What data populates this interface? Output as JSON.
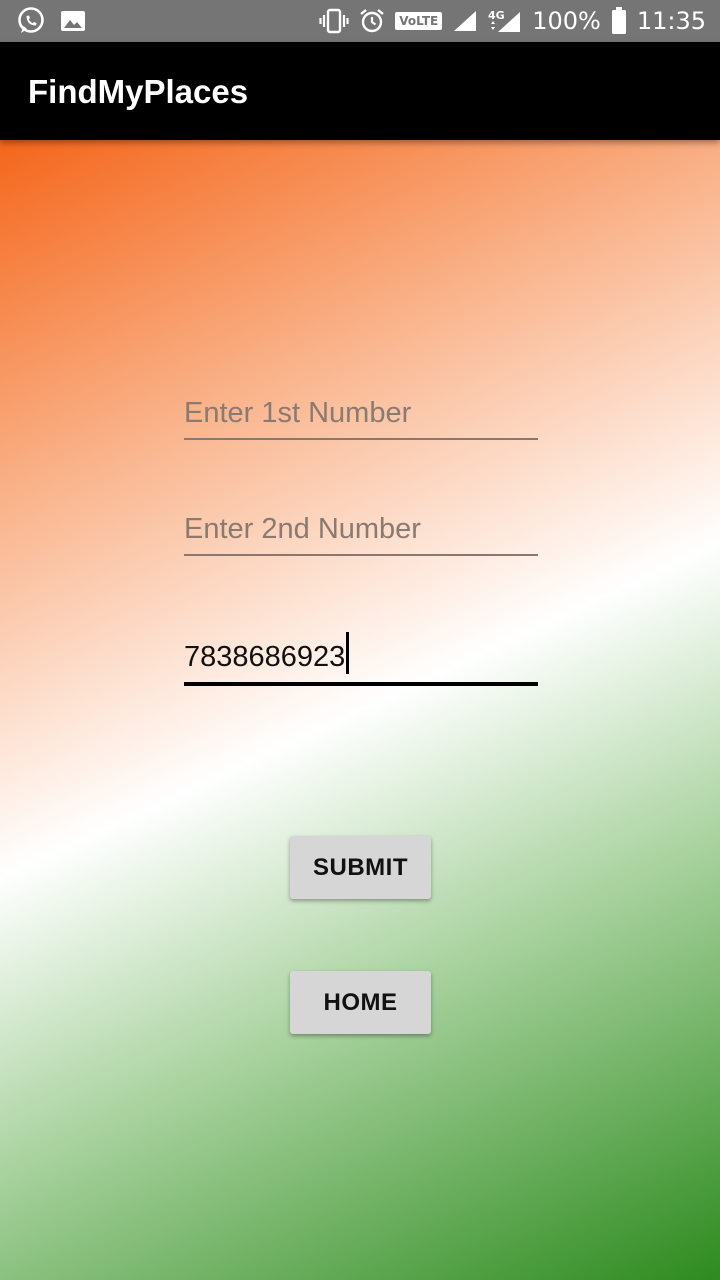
{
  "status_bar": {
    "battery_percent": "100%",
    "time": "11:35",
    "network": "4G",
    "volte_label": "VoLTE",
    "icons": [
      "whatsapp-icon",
      "gallery-icon",
      "vibrate-icon",
      "alarm-icon",
      "volte-icon",
      "signal-icon",
      "signal-4g-icon",
      "battery-icon"
    ]
  },
  "app_bar": {
    "title": "FindMyPlaces"
  },
  "form": {
    "field1": {
      "placeholder": "Enter 1st Number",
      "value": ""
    },
    "field2": {
      "placeholder": "Enter 2nd Number",
      "value": ""
    },
    "field3": {
      "placeholder": "",
      "value": "7838686923"
    }
  },
  "buttons": {
    "submit": "SUBMIT",
    "home": "HOME"
  },
  "colors": {
    "gradient_top": "#f4661b",
    "gradient_middle": "#ffffff",
    "gradient_bottom": "#2e8b1f",
    "app_bar": "#000000",
    "status_bar": "#757575",
    "button": "#d6d6d6"
  }
}
